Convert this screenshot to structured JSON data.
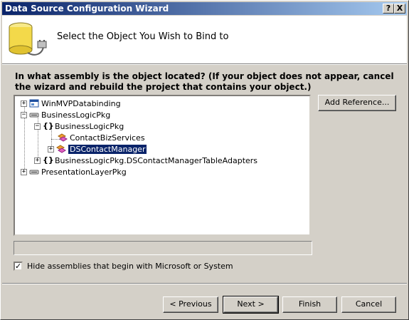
{
  "window": {
    "title": "Data Source Configuration Wizard",
    "help_btn": "?",
    "close_btn": "X"
  },
  "header": {
    "title": "Select the Object You Wish to Bind to"
  },
  "prompt": "In what assembly is the object located? (If your object does not appear, cancel the wizard and rebuild the project that contains your object.)",
  "tree": {
    "nodes": [
      {
        "label": "WinMVPDatabinding",
        "expander": "+",
        "icon": "project-icon"
      },
      {
        "label": "BusinessLogicPkg",
        "expander": "−",
        "icon": "assembly-icon"
      },
      {
        "label": "BusinessLogicPkg",
        "expander": "−",
        "icon": "namespace-icon",
        "glyph": "{}"
      },
      {
        "label": "ContactBizServices",
        "expander": "",
        "icon": "class-icon"
      },
      {
        "label": "DSContactManager",
        "expander": "+",
        "icon": "class-icon"
      },
      {
        "label": "BusinessLogicPkg.DSContactManagerTableAdapters",
        "expander": "+",
        "icon": "namespace-icon",
        "glyph": "{}"
      },
      {
        "label": "PresentationLayerPkg",
        "expander": "+",
        "icon": "assembly-icon"
      }
    ]
  },
  "add_reference_btn": "Add Reference...",
  "hide_checkbox": {
    "label": "Hide assemblies that begin with Microsoft or System",
    "checked": true,
    "mark": "✓"
  },
  "buttons": {
    "previous": "< Previous",
    "next": "Next >",
    "finish": "Finish",
    "cancel": "Cancel"
  }
}
